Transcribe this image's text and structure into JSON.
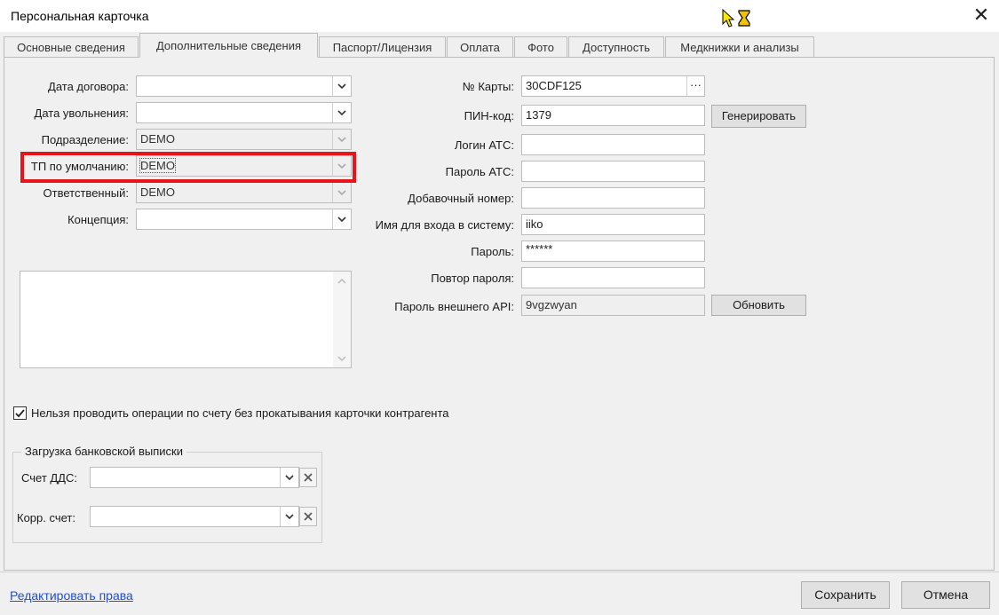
{
  "window": {
    "title": "Персональная карточка",
    "close_glyph": "✕"
  },
  "tabs": [
    {
      "label": "Основные сведения"
    },
    {
      "label": "Дополнительные сведения"
    },
    {
      "label": "Паспорт/Лицензия"
    },
    {
      "label": "Оплата"
    },
    {
      "label": "Фото"
    },
    {
      "label": "Доступность"
    },
    {
      "label": "Медкнижки и анализы"
    }
  ],
  "left_form": {
    "contract_date": {
      "label": "Дата договора:",
      "value": ""
    },
    "dismissal_date": {
      "label": "Дата увольнения:",
      "value": ""
    },
    "department": {
      "label": "Подразделение:",
      "value": "DEMO"
    },
    "default_tp": {
      "label": "ТП по умолчанию:",
      "value": "DEMO"
    },
    "responsible": {
      "label": "Ответственный:",
      "value": "DEMO"
    },
    "concept": {
      "label": "Концепция:",
      "value": ""
    }
  },
  "right_form": {
    "card_no": {
      "label": "№ Карты:",
      "value": "30CDF125",
      "button": "···"
    },
    "pin": {
      "label": "ПИН-код:",
      "value": "1379",
      "button": "Генерировать"
    },
    "ats_login": {
      "label": "Логин АТС:",
      "value": ""
    },
    "ats_password": {
      "label": "Пароль АТС:",
      "value": ""
    },
    "ext_number": {
      "label": "Добавочный номер:",
      "value": ""
    },
    "login_name": {
      "label": "Имя для входа в систему:",
      "value": "iiko"
    },
    "password": {
      "label": "Пароль:",
      "value": "******"
    },
    "password_repeat": {
      "label": "Повтор пароля:",
      "value": ""
    },
    "api_password": {
      "label": "Пароль внешнего API:",
      "value": "9vgzwyan",
      "button": "Обновить"
    }
  },
  "checkbox": {
    "label": "Нельзя проводить операции по счету без прокатывания карточки контрагента",
    "checked": true
  },
  "bank_group": {
    "title": "Загрузка банковской выписки",
    "account_dds": {
      "label": "Счет ДДС:",
      "value": ""
    },
    "corr_account": {
      "label": "Корр. счет:",
      "value": ""
    }
  },
  "footer": {
    "edit_rights": "Редактировать права",
    "save": "Сохранить",
    "cancel": "Отмена"
  },
  "colors": {
    "highlight": "#e8141b",
    "link": "#1f4fd6"
  }
}
